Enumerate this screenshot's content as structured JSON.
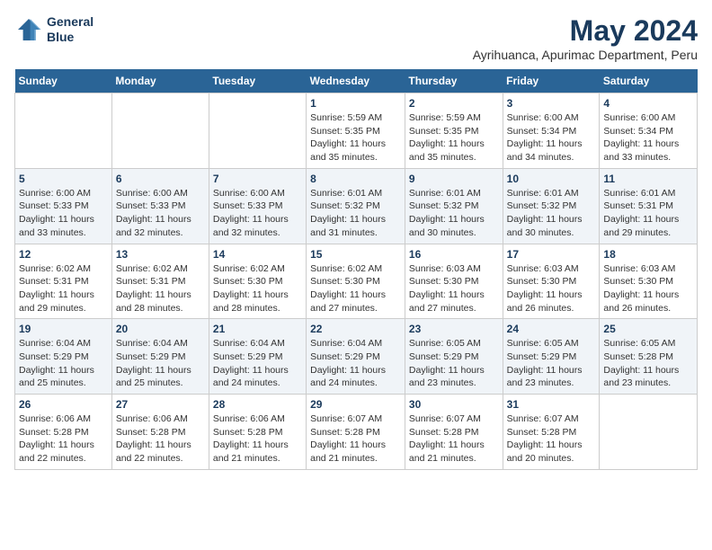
{
  "logo": {
    "line1": "General",
    "line2": "Blue"
  },
  "title": "May 2024",
  "subtitle": "Ayrihuanca, Apurimac Department, Peru",
  "days_of_week": [
    "Sunday",
    "Monday",
    "Tuesday",
    "Wednesday",
    "Thursday",
    "Friday",
    "Saturday"
  ],
  "weeks": [
    [
      {
        "day": "",
        "info": ""
      },
      {
        "day": "",
        "info": ""
      },
      {
        "day": "",
        "info": ""
      },
      {
        "day": "1",
        "info": "Sunrise: 5:59 AM\nSunset: 5:35 PM\nDaylight: 11 hours and 35 minutes."
      },
      {
        "day": "2",
        "info": "Sunrise: 5:59 AM\nSunset: 5:35 PM\nDaylight: 11 hours and 35 minutes."
      },
      {
        "day": "3",
        "info": "Sunrise: 6:00 AM\nSunset: 5:34 PM\nDaylight: 11 hours and 34 minutes."
      },
      {
        "day": "4",
        "info": "Sunrise: 6:00 AM\nSunset: 5:34 PM\nDaylight: 11 hours and 33 minutes."
      }
    ],
    [
      {
        "day": "5",
        "info": "Sunrise: 6:00 AM\nSunset: 5:33 PM\nDaylight: 11 hours and 33 minutes."
      },
      {
        "day": "6",
        "info": "Sunrise: 6:00 AM\nSunset: 5:33 PM\nDaylight: 11 hours and 32 minutes."
      },
      {
        "day": "7",
        "info": "Sunrise: 6:00 AM\nSunset: 5:33 PM\nDaylight: 11 hours and 32 minutes."
      },
      {
        "day": "8",
        "info": "Sunrise: 6:01 AM\nSunset: 5:32 PM\nDaylight: 11 hours and 31 minutes."
      },
      {
        "day": "9",
        "info": "Sunrise: 6:01 AM\nSunset: 5:32 PM\nDaylight: 11 hours and 30 minutes."
      },
      {
        "day": "10",
        "info": "Sunrise: 6:01 AM\nSunset: 5:32 PM\nDaylight: 11 hours and 30 minutes."
      },
      {
        "day": "11",
        "info": "Sunrise: 6:01 AM\nSunset: 5:31 PM\nDaylight: 11 hours and 29 minutes."
      }
    ],
    [
      {
        "day": "12",
        "info": "Sunrise: 6:02 AM\nSunset: 5:31 PM\nDaylight: 11 hours and 29 minutes."
      },
      {
        "day": "13",
        "info": "Sunrise: 6:02 AM\nSunset: 5:31 PM\nDaylight: 11 hours and 28 minutes."
      },
      {
        "day": "14",
        "info": "Sunrise: 6:02 AM\nSunset: 5:30 PM\nDaylight: 11 hours and 28 minutes."
      },
      {
        "day": "15",
        "info": "Sunrise: 6:02 AM\nSunset: 5:30 PM\nDaylight: 11 hours and 27 minutes."
      },
      {
        "day": "16",
        "info": "Sunrise: 6:03 AM\nSunset: 5:30 PM\nDaylight: 11 hours and 27 minutes."
      },
      {
        "day": "17",
        "info": "Sunrise: 6:03 AM\nSunset: 5:30 PM\nDaylight: 11 hours and 26 minutes."
      },
      {
        "day": "18",
        "info": "Sunrise: 6:03 AM\nSunset: 5:30 PM\nDaylight: 11 hours and 26 minutes."
      }
    ],
    [
      {
        "day": "19",
        "info": "Sunrise: 6:04 AM\nSunset: 5:29 PM\nDaylight: 11 hours and 25 minutes."
      },
      {
        "day": "20",
        "info": "Sunrise: 6:04 AM\nSunset: 5:29 PM\nDaylight: 11 hours and 25 minutes."
      },
      {
        "day": "21",
        "info": "Sunrise: 6:04 AM\nSunset: 5:29 PM\nDaylight: 11 hours and 24 minutes."
      },
      {
        "day": "22",
        "info": "Sunrise: 6:04 AM\nSunset: 5:29 PM\nDaylight: 11 hours and 24 minutes."
      },
      {
        "day": "23",
        "info": "Sunrise: 6:05 AM\nSunset: 5:29 PM\nDaylight: 11 hours and 23 minutes."
      },
      {
        "day": "24",
        "info": "Sunrise: 6:05 AM\nSunset: 5:29 PM\nDaylight: 11 hours and 23 minutes."
      },
      {
        "day": "25",
        "info": "Sunrise: 6:05 AM\nSunset: 5:28 PM\nDaylight: 11 hours and 23 minutes."
      }
    ],
    [
      {
        "day": "26",
        "info": "Sunrise: 6:06 AM\nSunset: 5:28 PM\nDaylight: 11 hours and 22 minutes."
      },
      {
        "day": "27",
        "info": "Sunrise: 6:06 AM\nSunset: 5:28 PM\nDaylight: 11 hours and 22 minutes."
      },
      {
        "day": "28",
        "info": "Sunrise: 6:06 AM\nSunset: 5:28 PM\nDaylight: 11 hours and 21 minutes."
      },
      {
        "day": "29",
        "info": "Sunrise: 6:07 AM\nSunset: 5:28 PM\nDaylight: 11 hours and 21 minutes."
      },
      {
        "day": "30",
        "info": "Sunrise: 6:07 AM\nSunset: 5:28 PM\nDaylight: 11 hours and 21 minutes."
      },
      {
        "day": "31",
        "info": "Sunrise: 6:07 AM\nSunset: 5:28 PM\nDaylight: 11 hours and 20 minutes."
      },
      {
        "day": "",
        "info": ""
      }
    ]
  ]
}
